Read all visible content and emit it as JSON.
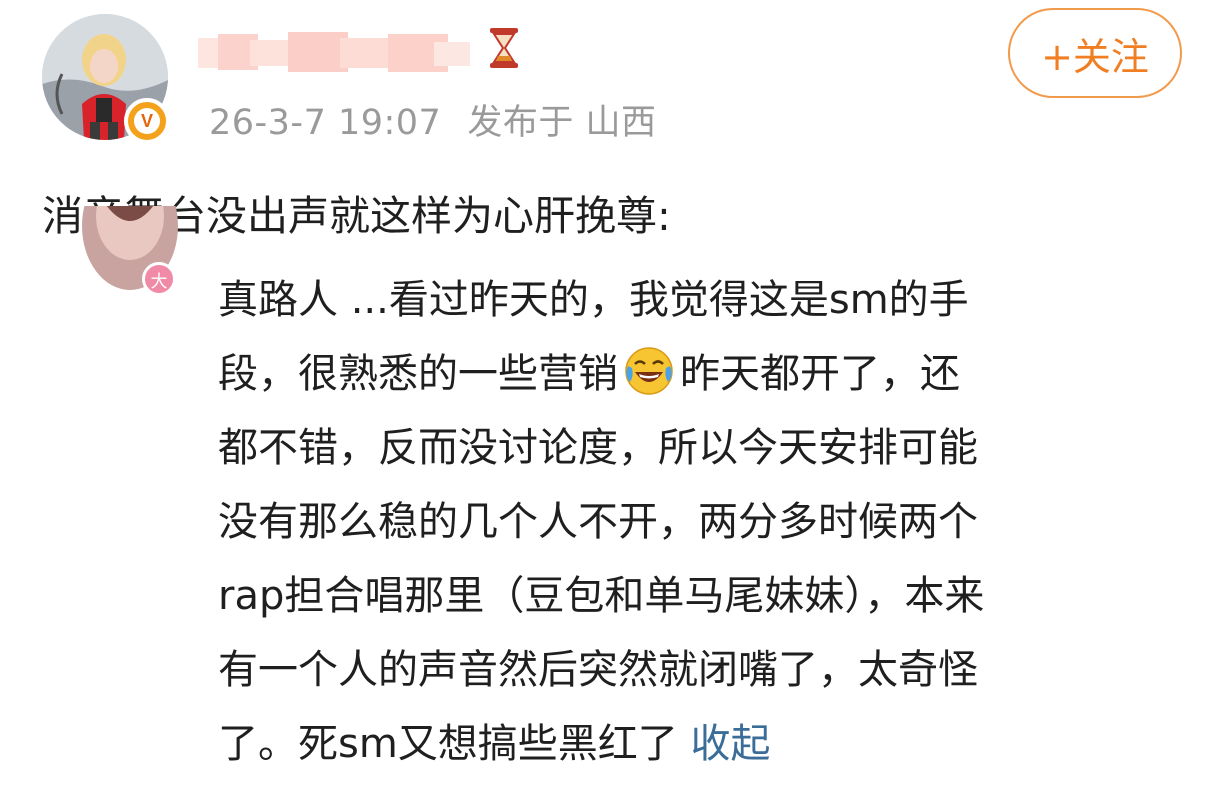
{
  "post": {
    "timestamp": "26-3-7 19:07",
    "location_label": "发布于 山西",
    "follow_label": "+关注",
    "text": "消音舞台没出声就这样为心肝挽尊:"
  },
  "badges": {
    "verified_glyph": "V",
    "rank_glyph": "大"
  },
  "comment": {
    "lines": [
      "真路人 ...看过昨天的，我觉得这是sm的手",
      "段，很熟悉的一些营销",
      "昨天都开了，还",
      "都不错，反而没讨论度，所以今天安排可能",
      "没有那么稳的几个人不开，两分多时候两个",
      "rap担合唱那里（豆包和单马尾妹妹），本来",
      "有一个人的声音然后突然就闭嘴了，太奇怪",
      "了。死sm又想搞些黑红了"
    ],
    "collapse_label": "收起",
    "emoji": "laughing-tears-emoji"
  },
  "colors": {
    "follow_accent": "#f07f24",
    "link": "#3b6d99",
    "meta_text": "#9a9a9a",
    "verified_badge": "#f4a21b",
    "rank_badge": "#f08aa6"
  }
}
